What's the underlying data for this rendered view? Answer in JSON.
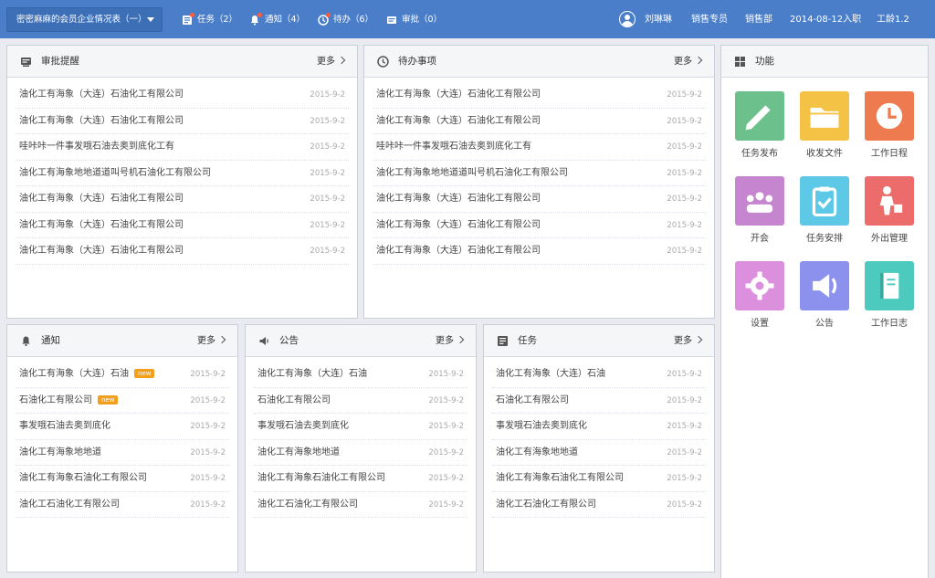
{
  "topbar": {
    "org_select": "密密麻麻的会员企业情况表（一）",
    "nav": [
      {
        "label": "任务（2）",
        "icon": "task-icon"
      },
      {
        "label": "通知（4）",
        "icon": "bell-icon"
      },
      {
        "label": "待办（6）",
        "icon": "clock-icon"
      },
      {
        "label": "审批（0）",
        "icon": "approval-icon"
      }
    ],
    "user": {
      "name": "刘琳琳",
      "role": "销售专员",
      "dept": "销售部",
      "hire": "2014-08-12入职",
      "tenure": "工龄1.2"
    }
  },
  "approval": {
    "title": "审批提醒",
    "more": "更多",
    "items": [
      {
        "text": "油化工有海象（大连）石油化工有限公司",
        "date": "2015-9-2"
      },
      {
        "text": "油化工有海象（大连）石油化工有限公司",
        "date": "2015-9-2"
      },
      {
        "text": "哇咔咔一件事发哦石油去奥到底化工有",
        "date": "2015-9-2"
      },
      {
        "text": "油化工有海象地地道道叫号机石油化工有限公司",
        "date": "2015-9-2"
      },
      {
        "text": "油化工有海象（大连）石油化工有限公司",
        "date": "2015-9-2"
      },
      {
        "text": "油化工有海象（大连）石油化工有限公司",
        "date": "2015-9-2"
      },
      {
        "text": "油化工有海象（大连）石油化工有限公司",
        "date": "2015-9-2"
      }
    ]
  },
  "todo": {
    "title": "待办事项",
    "more": "更多",
    "items": [
      {
        "text": "油化工有海象（大连）石油化工有限公司",
        "date": "2015-9-2"
      },
      {
        "text": "油化工有海象（大连）石油化工有限公司",
        "date": "2015-9-2"
      },
      {
        "text": "哇咔咔一件事发哦石油去奥到底化工有",
        "date": "2015-9-2"
      },
      {
        "text": "油化工有海象地地道道叫号机石油化工有限公司",
        "date": "2015-9-2"
      },
      {
        "text": "油化工有海象（大连）石油化工有限公司",
        "date": "2015-9-2"
      },
      {
        "text": "油化工有海象（大连）石油化工有限公司",
        "date": "2015-9-2"
      },
      {
        "text": "油化工有海象（大连）石油化工有限公司",
        "date": "2015-9-2"
      }
    ]
  },
  "functions": {
    "title": "功能",
    "tiles": [
      {
        "label": "任务发布",
        "color": "#6cc08b",
        "icon": "pencil-icon"
      },
      {
        "label": "收发文件",
        "color": "#f4c244",
        "icon": "folder-icon"
      },
      {
        "label": "工作日程",
        "color": "#ee7a4f",
        "icon": "clock-icon"
      },
      {
        "label": "开会",
        "color": "#c585cf",
        "icon": "meeting-icon"
      },
      {
        "label": "任务安排",
        "color": "#5ec9e6",
        "icon": "clipboard-check-icon"
      },
      {
        "label": "外出管理",
        "color": "#ec6b6b",
        "icon": "person-out-icon"
      },
      {
        "label": "设置",
        "color": "#dc8fdc",
        "icon": "gear-icon"
      },
      {
        "label": "公告",
        "color": "#8b91ec",
        "icon": "speaker-icon"
      },
      {
        "label": "工作日志",
        "color": "#4ccabe",
        "icon": "notebook-icon"
      }
    ]
  },
  "notice": {
    "title": "通知",
    "more": "更多",
    "new_label": "new",
    "items": [
      {
        "text": "油化工有海象（大连）石油",
        "date": "2015-9-2",
        "is_new": true
      },
      {
        "text": "石油化工有限公司",
        "date": "2015-9-2",
        "is_new": true
      },
      {
        "text": "事发哦石油去奥到底化",
        "date": "2015-9-2",
        "is_new": false
      },
      {
        "text": "油化工有海象地地道",
        "date": "2015-9-2",
        "is_new": false
      },
      {
        "text": "油化工有海象石油化工有限公司",
        "date": "2015-9-2",
        "is_new": false
      },
      {
        "text": "油化工石油化工有限公司",
        "date": "2015-9-2",
        "is_new": false
      }
    ]
  },
  "announce": {
    "title": "公告",
    "more": "更多",
    "items": [
      {
        "text": "油化工有海象（大连）石油",
        "date": "2015-9-2"
      },
      {
        "text": "石油化工有限公司",
        "date": "2015-9-2"
      },
      {
        "text": "事发哦石油去奥到底化",
        "date": "2015-9-2"
      },
      {
        "text": "油化工有海象地地道",
        "date": "2015-9-2"
      },
      {
        "text": "油化工有海象石油化工有限公司",
        "date": "2015-9-2"
      },
      {
        "text": "油化工石油化工有限公司",
        "date": "2015-9-2"
      }
    ]
  },
  "tasks": {
    "title": "任务",
    "more": "更多",
    "items": [
      {
        "text": "油化工有海象（大连）石油",
        "date": "2015-9-2"
      },
      {
        "text": "石油化工有限公司",
        "date": "2015-9-2"
      },
      {
        "text": "事发哦石油去奥到底化",
        "date": "2015-9-2"
      },
      {
        "text": "油化工有海象地地道",
        "date": "2015-9-2"
      },
      {
        "text": "油化工有海象石油化工有限公司",
        "date": "2015-9-2"
      },
      {
        "text": "油化工石油化工有限公司",
        "date": "2015-9-2"
      }
    ]
  }
}
